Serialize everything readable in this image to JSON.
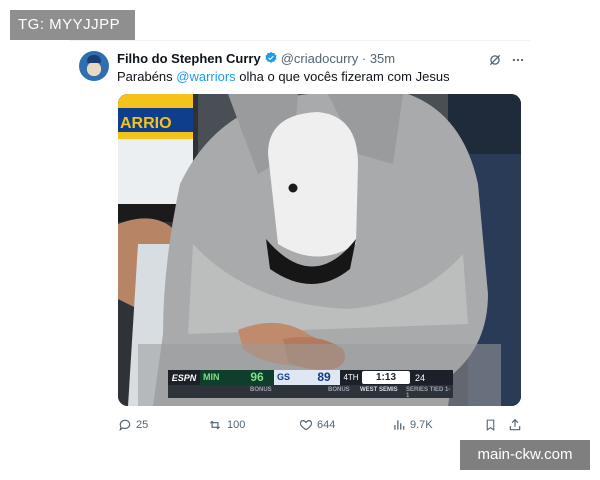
{
  "watermarks": {
    "top_left": "TG: MYYJJPP",
    "bottom_right": "main-ckw.com"
  },
  "tweet": {
    "author_name": "Filho do Stephen Curry",
    "handle": "@criadocurry",
    "separator": "·",
    "time": "35m",
    "text_before": "Parabéns ",
    "mention": "@warriors",
    "text_after": " olha o que vocês fizeram com Jesus",
    "verified_color": "#1d9bf0",
    "icons": [
      "grok-icon",
      "more-icon"
    ]
  },
  "media": {
    "scoreboard": {
      "network": "ESPN",
      "team1": "MIN",
      "score1": "96",
      "team2": "GS",
      "score2": "89",
      "period": "4TH",
      "clock": "1:13",
      "shot_clock": "24",
      "bonus_left": "BONUS",
      "bonus_right": "BONUS",
      "series_label": "WEST SEMIS",
      "series_status": "SERIES TIED 1-1",
      "team1_color": "#0f3e2d",
      "team2_color": "#0d3b85"
    }
  },
  "actions": {
    "replies": "25",
    "reposts": "100",
    "likes": "644",
    "views": "9.7K"
  }
}
